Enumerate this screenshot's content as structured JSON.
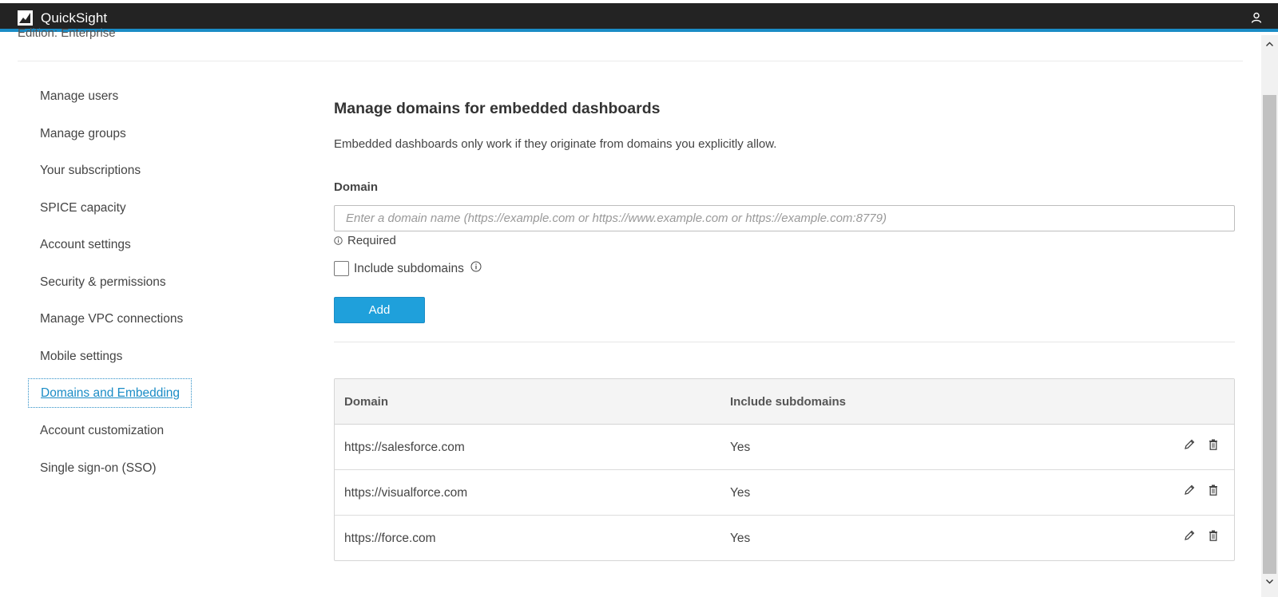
{
  "app": {
    "brand": "QuickSight"
  },
  "edition": "Edition: Enterprise",
  "sidebar": {
    "items": [
      {
        "label": "Manage users"
      },
      {
        "label": "Manage groups"
      },
      {
        "label": "Your subscriptions"
      },
      {
        "label": "SPICE capacity"
      },
      {
        "label": "Account settings"
      },
      {
        "label": "Security & permissions"
      },
      {
        "label": "Manage VPC connections"
      },
      {
        "label": "Mobile settings"
      },
      {
        "label": "Domains and Embedding",
        "active": true
      },
      {
        "label": "Account customization"
      },
      {
        "label": "Single sign-on (SSO)"
      }
    ]
  },
  "main": {
    "title": "Manage domains for embedded dashboards",
    "description": "Embedded dashboards only work if they originate from domains you explicitly allow.",
    "domain_label": "Domain",
    "domain_input": {
      "value": "",
      "placeholder": "Enter a domain name (https://example.com or https://www.example.com or https://example.com:8779)"
    },
    "required_text": "Required",
    "include_subdomains_label": "Include subdomains",
    "include_subdomains_checked": false,
    "add_label": "Add"
  },
  "table": {
    "headers": [
      "Domain",
      "Include subdomains"
    ],
    "rows": [
      {
        "domain": "https://salesforce.com",
        "include_subdomains": "Yes"
      },
      {
        "domain": "https://visualforce.com",
        "include_subdomains": "Yes"
      },
      {
        "domain": "https://force.com",
        "include_subdomains": "Yes"
      }
    ]
  },
  "colors": {
    "topbar": "#232323",
    "accent": "#1a8cc6",
    "button": "#1fa0db"
  },
  "icons": [
    "quicksight-logo-icon",
    "user-icon",
    "info-icon",
    "edit-icon",
    "delete-icon",
    "scroll-up-icon",
    "scroll-down-icon"
  ]
}
